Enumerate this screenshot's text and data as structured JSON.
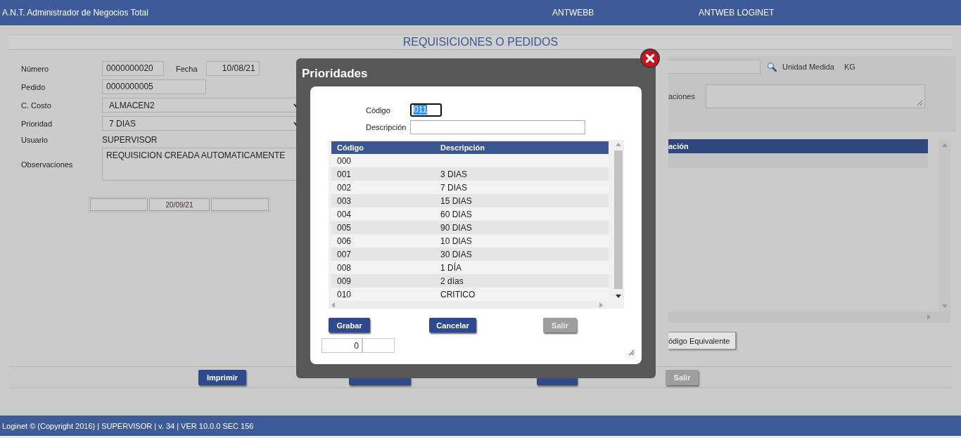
{
  "app_bar": {
    "title": "A.N.T. Administrador de Negocios Total",
    "company": "ANTWEBB",
    "site": "ANTWEB LOGINET"
  },
  "page_title": "REQUISICIONES O PEDIDOS",
  "form": {
    "numero_label": "Número",
    "numero": "0000000020",
    "fecha_label": "Fecha",
    "fecha": "10/08/21",
    "pedido_label": "Pedido",
    "pedido": "0000000005",
    "costo_label": "C. Costo",
    "costo": "ALMACEN2",
    "prioridad_label": "Prioridad",
    "prioridad": "7 DIAS",
    "usuario_label": "Usuario",
    "usuario": "SUPERVISOR",
    "observaciones_label": "Observaciones",
    "observaciones": "REQUISICION CREADA AUTOMATICAMENTE",
    "date_strip_middle": "20/09/21"
  },
  "detail_panel": {
    "observaciones_label": "aciones",
    "unit_label": "Unidad Medida",
    "unit_value": "KG",
    "grid_header": "ación",
    "equivalent_button": "ódigo Equivalente"
  },
  "action_bar": {
    "buttons": [
      {
        "label": "Imprimir",
        "disabled": false
      },
      {
        "disabled": false
      },
      {
        "disabled": false
      },
      {
        "label": "Salir",
        "disabled": true
      }
    ]
  },
  "footer": "Loginet © (Copyright 2016) | SUPERVISOR | v. 34 | VER 10.0.0 SEC 156",
  "dialog": {
    "title": "Prioridades",
    "codigo_label": "Código",
    "codigo": "011",
    "codigo_selected": true,
    "descripcion_label": "Descripción",
    "table": {
      "columns": [
        "Código",
        "Descripción"
      ],
      "rows": [
        {
          "codigo": "000"
        },
        {
          "codigo": "001",
          "descripcion": "3 DIAS"
        },
        {
          "codigo": "002",
          "descripcion": "7 DIAS"
        },
        {
          "codigo": "003",
          "descripcion": "15 DIAS"
        },
        {
          "codigo": "004",
          "descripcion": "60 DIAS"
        },
        {
          "codigo": "005",
          "descripcion": "90 DIAS"
        },
        {
          "codigo": "006",
          "descripcion": "10 DIAS"
        },
        {
          "codigo": "007",
          "descripcion": "30 DIAS"
        },
        {
          "codigo": "008",
          "descripcion": "1 DÍA"
        },
        {
          "codigo": "009",
          "descripcion": "2 días"
        },
        {
          "codigo": "010",
          "descripcion": "CRITICO"
        }
      ]
    },
    "buttons": [
      {
        "label": "Grabar",
        "disabled": false
      },
      {
        "label": "Cancelar",
        "disabled": false
      },
      {
        "label": "Salir",
        "disabled": true
      }
    ],
    "counter": "0"
  }
}
